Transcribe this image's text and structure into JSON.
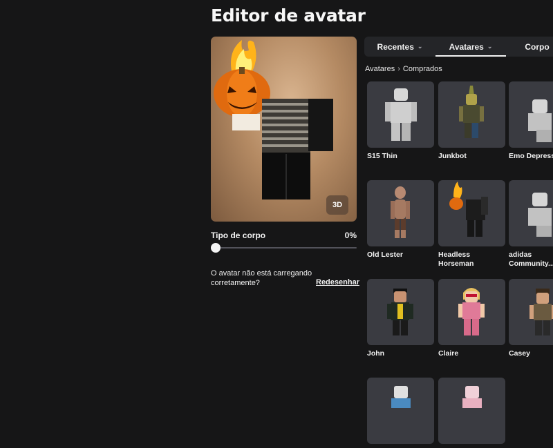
{
  "page": {
    "title": "Editor de avatar"
  },
  "preview": {
    "view_toggle_label": "3D"
  },
  "body_type": {
    "label": "Tipo de corpo",
    "value": "0%",
    "level_fraction": 0
  },
  "loading_help": {
    "message": "O avatar não está carregando corretamente?",
    "redraw_link": "Redesenhar"
  },
  "tabs": [
    {
      "label": "Recentes",
      "has_dropdown": true,
      "active": false
    },
    {
      "label": "Avatares",
      "has_dropdown": true,
      "active": true
    },
    {
      "label": "Corpo",
      "has_dropdown": false,
      "active": false
    }
  ],
  "breadcrumb": {
    "root": "Avatares",
    "current": "Comprados",
    "separator_icon": "chevron-right-icon"
  },
  "avatars": [
    {
      "name": "S15 Thin"
    },
    {
      "name": "Junkbot"
    },
    {
      "name": "Emo Depress"
    },
    {
      "name": "Old Lester"
    },
    {
      "name": "Headless Horseman"
    },
    {
      "name": "adidas Community..."
    },
    {
      "name": "John"
    },
    {
      "name": "Claire"
    },
    {
      "name": "Casey"
    },
    {
      "name": ""
    },
    {
      "name": ""
    }
  ],
  "colors": {
    "background": "#161617",
    "card": "#3a3b41",
    "tab_bar": "#242528",
    "text": "#f2f2f2"
  }
}
